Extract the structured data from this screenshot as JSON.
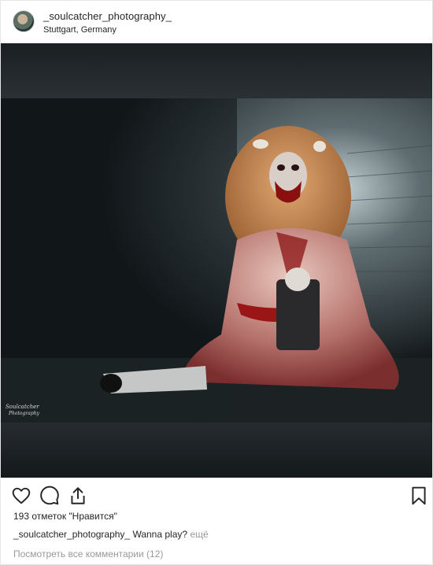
{
  "header": {
    "username": "_soulcatcher_photography_",
    "location": "Stuttgart, Germany"
  },
  "photo": {
    "watermark": "Soulcatcher Photography"
  },
  "actions": {
    "icons": [
      "heart-icon",
      "comment-icon",
      "share-icon",
      "bookmark-icon"
    ]
  },
  "likes": "193 отметок \"Нравится\"",
  "caption": {
    "username": "_soulcatcher_photography_",
    "text": "Wanna play?",
    "more": "ещё"
  },
  "comments_link": "Посмотреть все комментарии (12)",
  "colors": {
    "text": "#262626",
    "muted": "#999999",
    "border": "#e6e6e6"
  }
}
